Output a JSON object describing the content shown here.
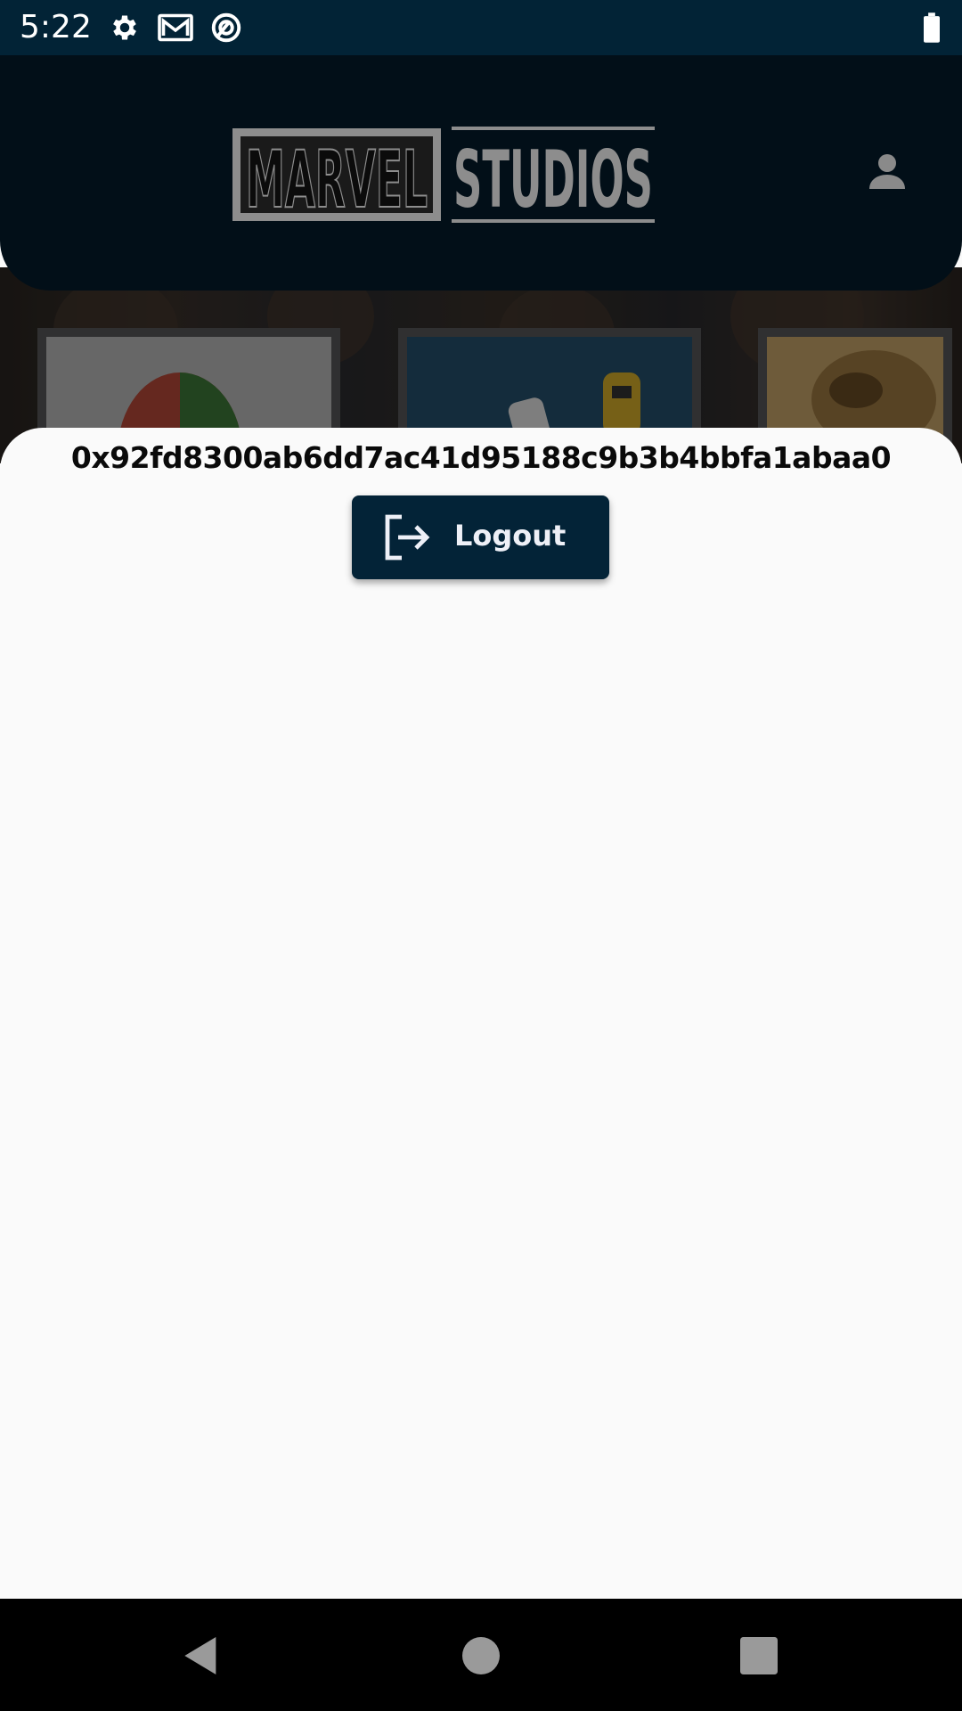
{
  "status_bar": {
    "time": "5:22",
    "icons": [
      "settings-icon",
      "gmail-icon",
      "vpn-icon",
      "battery-icon"
    ]
  },
  "header": {
    "logo_text_left": "MARVEL",
    "logo_text_right": "STUDIOS",
    "profile_icon": "person-icon"
  },
  "sheet": {
    "wallet_address": "0x92fd8300ab6dd7ac41d95188c9b3b4bbfa1abaa0",
    "logout_label": "Logout",
    "logout_icon": "logout-icon"
  },
  "nav_bar": {
    "buttons": [
      "back-icon",
      "home-icon",
      "recents-icon"
    ]
  },
  "colors": {
    "status_bar": "#022336",
    "header": "#020f18",
    "button": "#032337",
    "sheet": "#fafafa"
  }
}
